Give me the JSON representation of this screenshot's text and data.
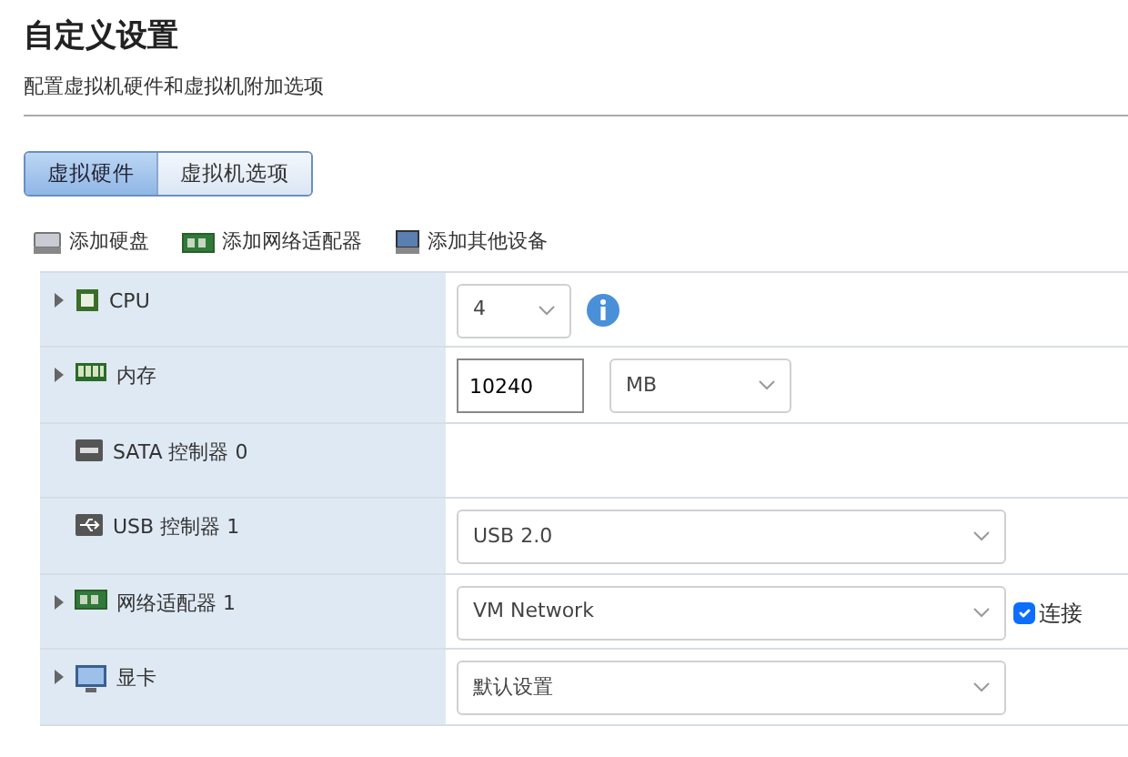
{
  "header": {
    "title": "自定义设置",
    "subtitle": "配置虚拟机硬件和虚拟机附加选项"
  },
  "tabs": [
    {
      "label": "虚拟硬件",
      "selected": true
    },
    {
      "label": "虚拟机选项",
      "selected": false
    }
  ],
  "toolbar": [
    {
      "label": "添加硬盘"
    },
    {
      "label": "添加网络适配器"
    },
    {
      "label": "添加其他设备"
    }
  ],
  "devices": [
    {
      "label": "CPU",
      "expandable": true,
      "controls": [
        {
          "kind": "short-select",
          "value": "4"
        },
        {
          "kind": "info"
        }
      ]
    },
    {
      "label": "内存",
      "expandable": true,
      "controls": [
        {
          "kind": "input",
          "value": "10240"
        },
        {
          "kind": "unit-select",
          "value": "MB"
        }
      ]
    },
    {
      "label": "SATA 控制器 0",
      "expandable": false
    },
    {
      "label": "USB 控制器 1",
      "expandable": false,
      "controls": [
        {
          "kind": "select",
          "value": "USB 2.0"
        }
      ]
    },
    {
      "label": "网络适配器 1",
      "expandable": true,
      "controls": [
        {
          "kind": "select",
          "value": "VM Network"
        },
        {
          "kind": "checkbox",
          "label": "连接",
          "checked": true
        }
      ]
    },
    {
      "label": "显卡",
      "expandable": true,
      "controls": [
        {
          "kind": "select",
          "value": "默认设置"
        }
      ]
    }
  ]
}
